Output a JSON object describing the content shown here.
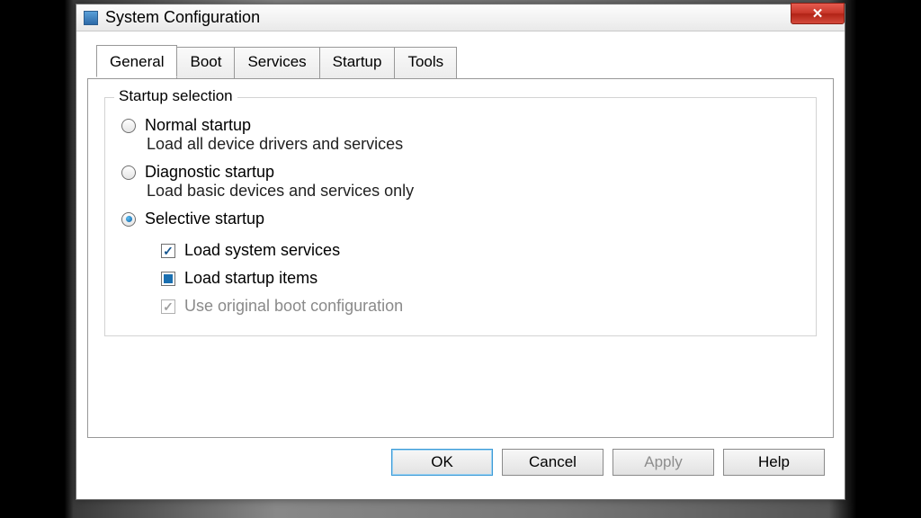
{
  "window": {
    "title": "System Configuration"
  },
  "tabs": {
    "general": "General",
    "boot": "Boot",
    "services": "Services",
    "startup": "Startup",
    "tools": "Tools"
  },
  "group": {
    "title": "Startup selection"
  },
  "options": {
    "normal": {
      "label": "Normal startup",
      "desc": "Load all device drivers and services"
    },
    "diagnostic": {
      "label": "Diagnostic startup",
      "desc": "Load basic devices and services only"
    },
    "selective": {
      "label": "Selective startup"
    }
  },
  "subs": {
    "system_services": "Load system services",
    "startup_items": "Load startup items",
    "orig_boot": "Use original boot configuration"
  },
  "buttons": {
    "ok": "OK",
    "cancel": "Cancel",
    "apply": "Apply",
    "help": "Help"
  }
}
